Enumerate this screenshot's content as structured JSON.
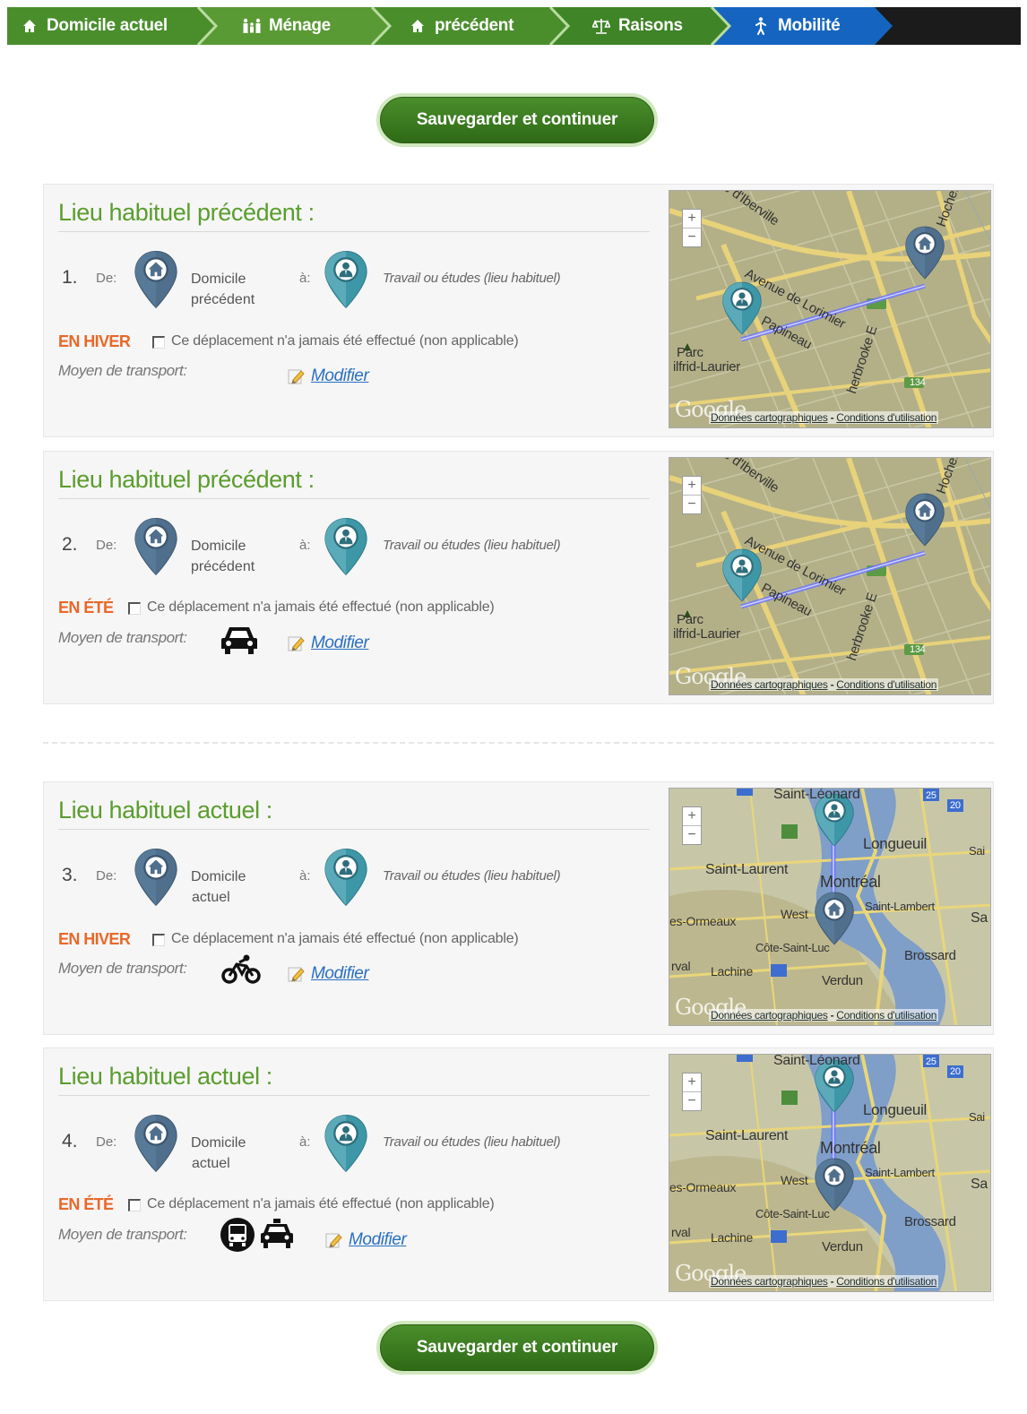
{
  "breadcrumb": [
    {
      "label": "Domicile actuel",
      "icon": "home-icon"
    },
    {
      "label": "Ménage",
      "icon": "family-icon"
    },
    {
      "label": "précédent",
      "icon": "home-icon"
    },
    {
      "label": "Raisons",
      "icon": "balance-icon"
    },
    {
      "label": "Mobilité",
      "icon": "walking-icon"
    }
  ],
  "save_label": "Sauvegarder et continuer",
  "common": {
    "de": "De:",
    "a": "à:",
    "destination": "Travail ou études (lieu habituel)",
    "checkbox_label": "Ce déplacement n'a jamais été effectué (non applicable)",
    "moyen": "Moyen de transport:",
    "modifier": "Modifier",
    "map_google": "Google",
    "map_terms_a": "Données cartographiques",
    "map_terms_sep": " - ",
    "map_terms_b": "Conditions d'utilisation"
  },
  "cards": [
    {
      "title": "Lieu habituel précédent :",
      "number": "1.",
      "origin": "Domicile précédent",
      "origin_l1": "Domicile",
      "origin_l2": "précédent",
      "season": "EN HIVER",
      "transport": []
    },
    {
      "title": "Lieu habituel précédent :",
      "number": "2.",
      "origin": "Domicile précédent",
      "origin_l1": "Domicile",
      "origin_l2": "précédent",
      "season": "EN ÉTÉ",
      "transport": [
        "car-icon"
      ]
    },
    {
      "title": "Lieu habituel actuel :",
      "number": "3.",
      "origin": "Domicile actuel",
      "origin_l1": "Domicile",
      "origin_l2": "actuel",
      "season": "EN HIVER",
      "transport": [
        "bicycle-icon"
      ]
    },
    {
      "title": "Lieu habituel actuel :",
      "number": "4.",
      "origin": "Domicile actuel",
      "origin_l1": "Domicile",
      "origin_l2": "actuel",
      "season": "EN ÉTÉ",
      "transport": [
        "bus-icon",
        "taxi-icon"
      ]
    }
  ],
  "map_a_labels": {
    "parc": "Parc",
    "laurier": "ilfrid-Laurier",
    "rue": "ue d'Iberville",
    "lorimier": "Avenue de Lorimier",
    "papineau": "Papineau",
    "sherbrooke": "herbrooke E",
    "hochel": "Hochel",
    "road": "134"
  },
  "map_b_labels": {
    "leonard": "Saint-Léonard",
    "longueuil": "Longueuil",
    "laurent": "Saint-Laurent",
    "montreal": "Montréal",
    "lambert": "Saint-Lambert",
    "ormeaux": "es-Ormeaux",
    "west": "West",
    "cote": "Côte-Saint-Luc",
    "brossard": "Brossard",
    "lachine": "Lachine",
    "verdun": "Verdun",
    "rval": "rval",
    "sa": "Sa",
    "sai": "Sai",
    "r25": "25",
    "r20": "20"
  },
  "colors": {
    "brand_green": "#5a9d2d",
    "season_orange": "#e8682a",
    "link_blue": "#2a6fc0",
    "pin_home": "#4f6f8c",
    "pin_work": "#3d97a7",
    "breadcrumb_active": "#1565c0"
  }
}
